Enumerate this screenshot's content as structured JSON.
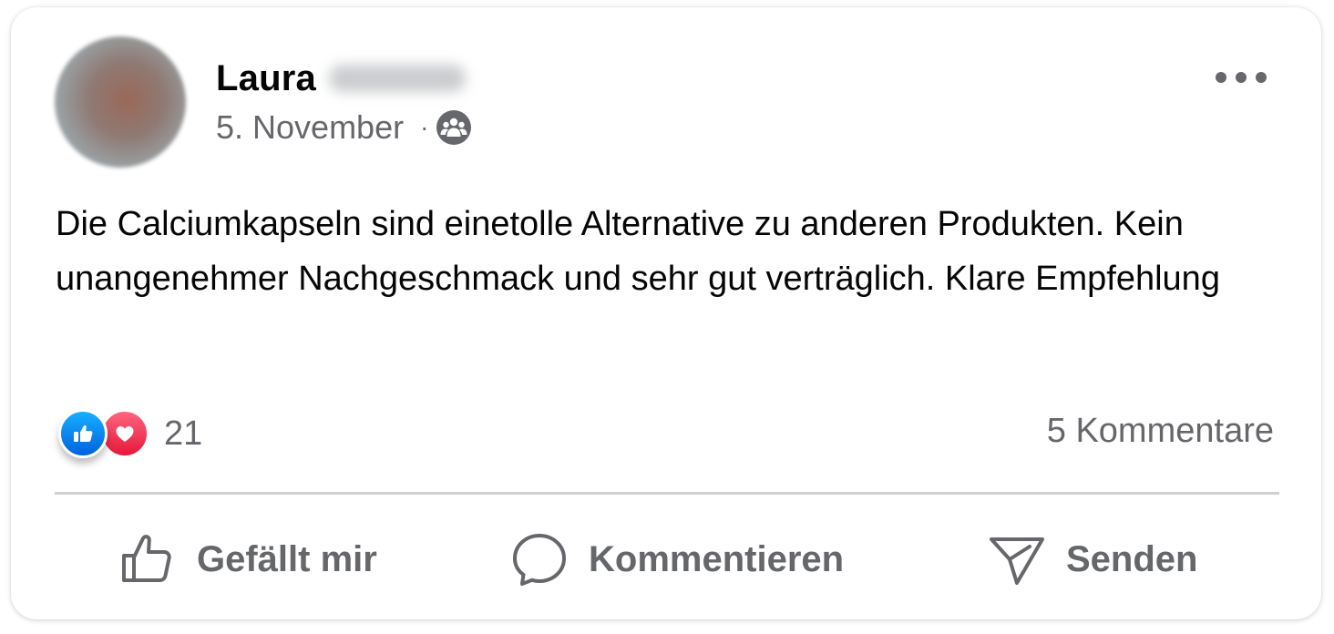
{
  "post": {
    "author_first_name": "Laura",
    "date": "5. November",
    "separator": "·",
    "audience_icon": "friends-group-icon",
    "more_icon": "more-options-icon",
    "text": "Die Calciumkapseln sind einetolle Alternative zu anderen Produkten. Kein unangenehmer Nachgeschmack und sehr gut verträglich. Klare Empfehlung"
  },
  "engagement": {
    "reactions": [
      "like-reaction-icon",
      "love-reaction-icon"
    ],
    "reaction_count": "21",
    "comments_label": "5 Kommentare"
  },
  "actions": {
    "like_label": "Gefällt mir",
    "comment_label": "Kommentieren",
    "send_label": "Senden"
  },
  "colors": {
    "text_primary": "#050505",
    "text_secondary": "#65676b",
    "like_blue": "#0866ff",
    "love_red": "#f33e58",
    "divider": "#ced0d4"
  }
}
